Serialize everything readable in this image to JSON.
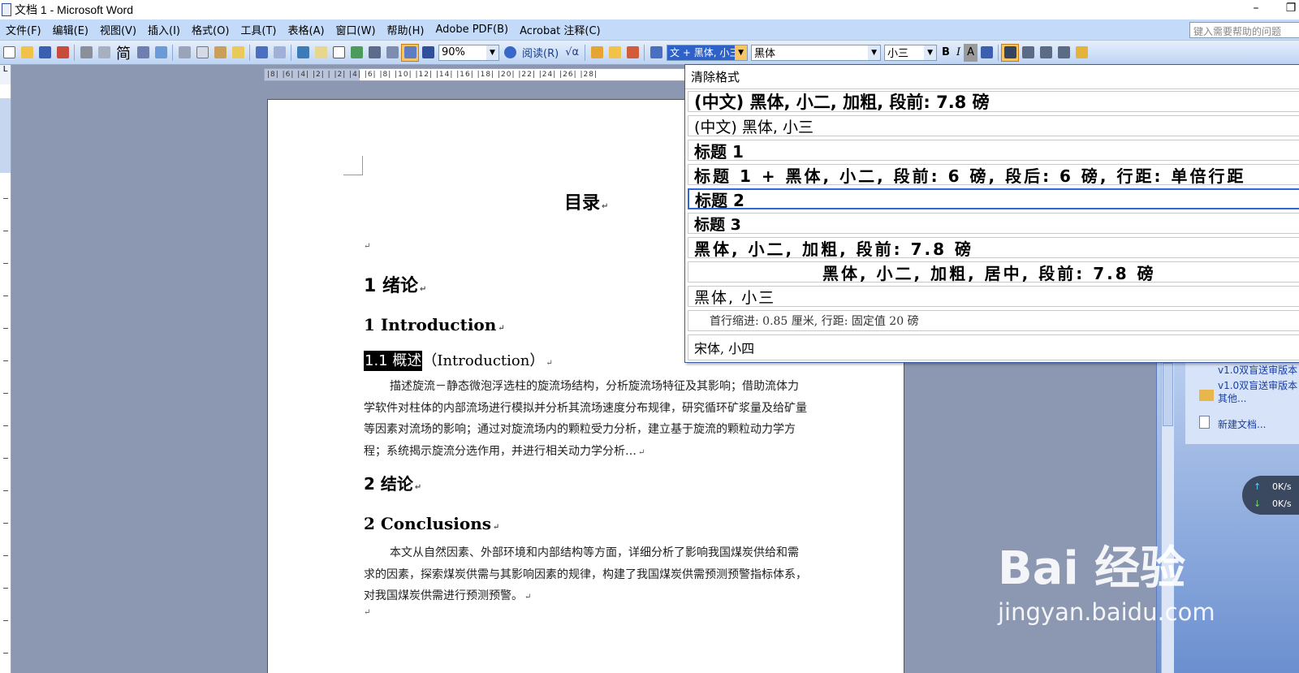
{
  "window": {
    "title": "文档 1 - Microsoft Word",
    "min": "–",
    "restore": "❐"
  },
  "menu": [
    "文件(F)",
    "编辑(E)",
    "视图(V)",
    "插入(I)",
    "格式(O)",
    "工具(T)",
    "表格(A)",
    "窗口(W)",
    "帮助(H)",
    "Adobe PDF(B)",
    "Acrobat 注释(C)"
  ],
  "help_placeholder": "键入需要帮助的问题",
  "toolbar": {
    "simplified": "简",
    "zoom": "90%",
    "read": "阅读(R)",
    "style": "文 + 黑体, 小三",
    "font": "黑体",
    "size": "小三",
    "bold": "B",
    "italic": "I",
    "underline": "A"
  },
  "ruler": {
    "text": "|8| |6| |4| |2| |  |2| |4| |6| |8| |10| |12| |14| |16| |18| |20| |22| |24| |26| |28|"
  },
  "document": {
    "title": "目录",
    "h1_cn": "1  绪论",
    "h1_en": "1 Introduction",
    "h2_sel": "1.1 概述",
    "h2_rest": "（Introduction）",
    "p1": "描述旋流－静态微泡浮选柱的旋流场结构，分析旋流场特征及其影响；借助流体力学软件对柱体的内部流场进行模拟并分析其流场速度分布规律，研究循环矿浆量及给矿量等因素对流场的影响；通过对旋流场内的颗粒受力分析，建立基于旋流的颗粒动力学方程；系统揭示旋流分选作用，并进行相关动力学分析…",
    "h1_cn2": "2  结论",
    "h1_en2": "2 Conclusions",
    "p2": "本文从自然因素、外部环境和内部结构等方面，详细分析了影响我国煤炭供给和需求的因素，探索煤炭供需与其影响因素的规律，构建了我国煤炭供需预测预警指标体系，对我国煤炭供需进行预测预警。",
    "para_mark": "↵"
  },
  "style_list": [
    "清除格式",
    "(中文) 黑体, 小二, 加粗, 段前: 7.8 磅",
    "(中文) 黑体, 小三",
    "标题 1",
    "标题 1 + 黑体, 小二, 段前: 6 磅, 段后: 6 磅, 行距: 单倍行距",
    "标题 2",
    "标题 3",
    "黑体, 小二, 加粗, 段前: 7.8 磅",
    "黑体, 小二, 加粗, 居中, 段前: 7.8 磅",
    "黑体, 小三",
    "首行缩进: 0.85 厘米, 行距: 固定值 20 磅",
    "宋体, 小四"
  ],
  "task_pane": {
    "links": [
      "v1.0双盲送审版本",
      "v1.0双盲送审版本",
      "其他...",
      "新建文档..."
    ]
  },
  "speed": {
    "up": "0K/s",
    "down": "0K/s"
  },
  "watermark": {
    "brand": "Bai 经验",
    "url": "jingyan.baidu.com"
  }
}
